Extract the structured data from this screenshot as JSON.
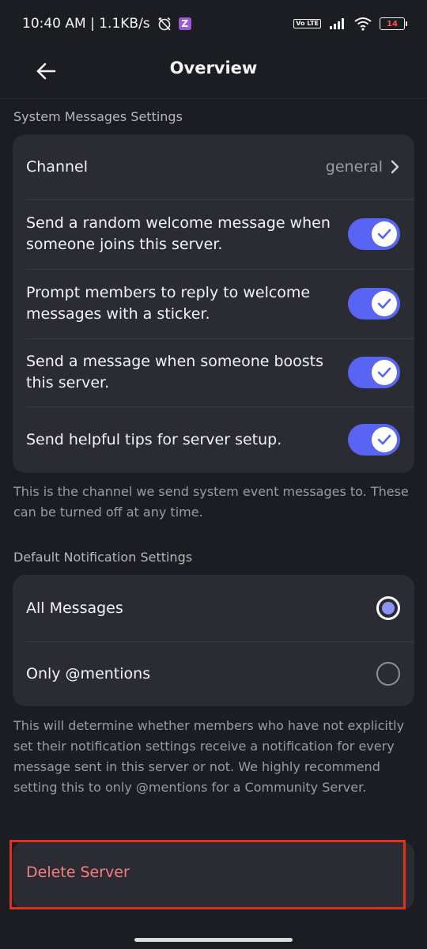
{
  "status_bar": {
    "time_speed": "10:40 AM | 1.1KB/s",
    "z_badge": "Z",
    "volte": "Vo LTE",
    "battery": "14"
  },
  "header": {
    "title": "Overview"
  },
  "system_messages": {
    "label": "System Messages Settings",
    "channel_label": "Channel",
    "channel_value": "general",
    "toggles": [
      {
        "label": "Send a random welcome message when someone joins this server.",
        "on": true
      },
      {
        "label": "Prompt members to reply to welcome messages with a sticker.",
        "on": true
      },
      {
        "label": "Send a message when someone boosts this server.",
        "on": true
      },
      {
        "label": "Send helpful tips for server setup.",
        "on": true
      }
    ],
    "note": "This is the channel we send system event messages to. These can be turned off at any time."
  },
  "notifications": {
    "label": "Default Notification Settings",
    "options": [
      {
        "label": "All Messages",
        "selected": true
      },
      {
        "label": "Only @mentions",
        "selected": false
      }
    ],
    "note": "This will determine whether members who have not explicitly set their notification settings receive a notification for every message sent in this server or not. We highly recommend setting this to only @mentions for a Community Server."
  },
  "danger": {
    "delete_label": "Delete Server"
  },
  "colors": {
    "accent": "#5865f2",
    "danger_text": "#f57f7f",
    "highlight": "#e1301c"
  }
}
